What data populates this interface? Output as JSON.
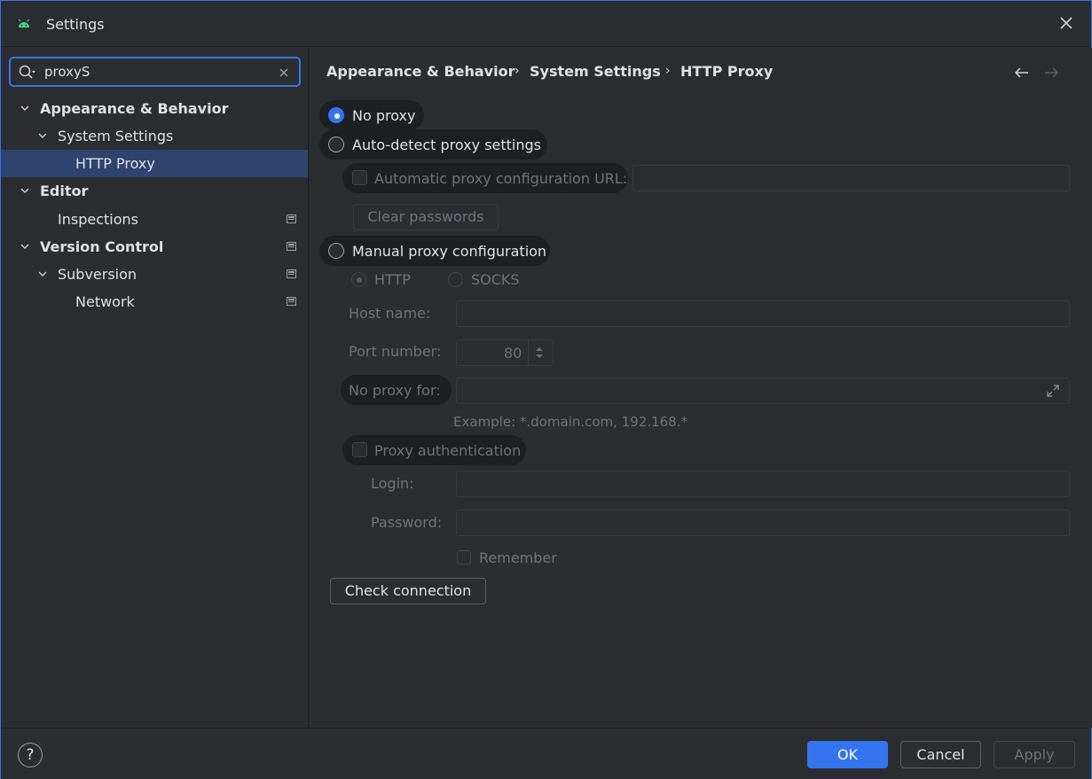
{
  "window": {
    "title": "Settings"
  },
  "search": {
    "value": "proxyS",
    "placeholder": ""
  },
  "tree": {
    "items": [
      {
        "label": "Appearance & Behavior",
        "bold": true
      },
      {
        "label": "System Settings"
      },
      {
        "label": "HTTP Proxy",
        "selected": true
      },
      {
        "label": "Editor",
        "bold": true
      },
      {
        "label": "Inspections"
      },
      {
        "label": "Version Control",
        "bold": true
      },
      {
        "label": "Subversion"
      },
      {
        "label": "Network"
      }
    ]
  },
  "breadcrumb": [
    "Appearance & Behavior",
    "System Settings",
    "HTTP Proxy"
  ],
  "breadcrumb_sep": "›",
  "proxy": {
    "no_proxy": "No proxy",
    "auto_detect": "Auto-detect proxy settings",
    "auto_config_url": "Automatic proxy configuration URL:",
    "clear_passwords": "Clear passwords",
    "manual": "Manual proxy configuration",
    "http": "HTTP",
    "socks": "SOCKS",
    "host_label": "Host name:",
    "port_label": "Port number:",
    "port_value": "80",
    "no_proxy_for_label": "No proxy for:",
    "example": "Example: *.domain.com, 192.168.*",
    "auth": "Proxy authentication",
    "login_label": "Login:",
    "password_label": "Password:",
    "remember": "Remember",
    "check_connection": "Check connection"
  },
  "buttons": {
    "help": "?",
    "ok": "OK",
    "cancel": "Cancel",
    "apply": "Apply"
  },
  "colors": {
    "accent": "#3574f0",
    "background": "#2b2d30",
    "selection": "#2e436e"
  }
}
